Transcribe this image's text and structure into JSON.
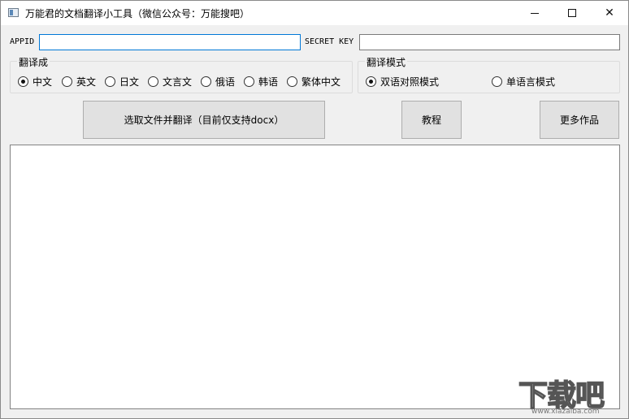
{
  "window": {
    "title": "万能君的文档翻译小工具（微信公众号：万能搜吧）",
    "minimize": "—",
    "maximize": "☐",
    "close": "✕"
  },
  "credentials": {
    "appid_label": "APPID",
    "appid_value": "",
    "secret_label": "SECRET KEY",
    "secret_value": ""
  },
  "target_language": {
    "title": "翻译成",
    "options": [
      "中文",
      "英文",
      "日文",
      "文言文",
      "俄语",
      "韩语",
      "繁体中文"
    ],
    "selected": "中文"
  },
  "mode": {
    "title": "翻译模式",
    "options": [
      "双语对照模式",
      "单语言模式"
    ],
    "selected": "双语对照模式"
  },
  "buttons": {
    "select_file": "选取文件并翻译（目前仅支持docx）",
    "tutorial": "教程",
    "more": "更多作品"
  },
  "output": {
    "text": ""
  },
  "watermark": {
    "brand": "下载吧",
    "url": "www.xiazaiba.com"
  },
  "colors": {
    "focus_border": "#0078d7",
    "button_bg": "#e1e1e1",
    "window_bg": "#f0f0f0"
  }
}
